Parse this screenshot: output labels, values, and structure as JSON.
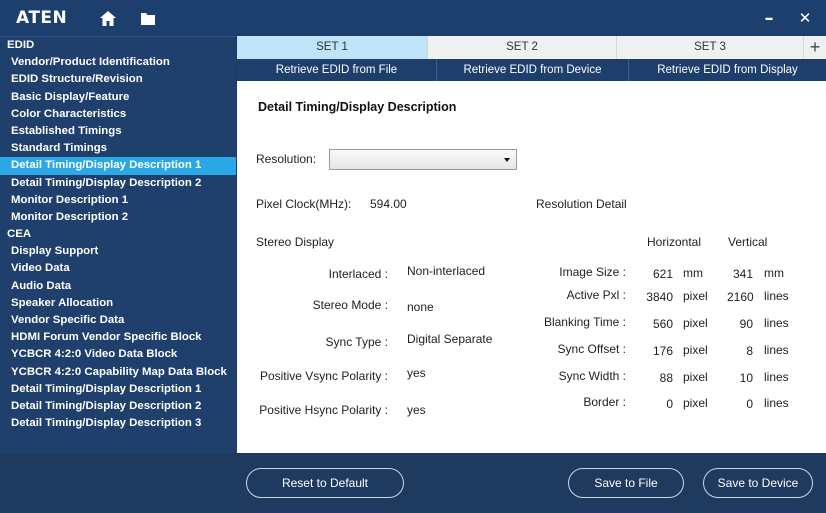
{
  "titlebar": {
    "logo": "ATEN",
    "home_icon": "home-icon",
    "folder_icon": "folder-icon",
    "minimize_label": "–",
    "close_label": "✕"
  },
  "sidebar": {
    "items": [
      {
        "label": "EDID",
        "section": true,
        "active": false
      },
      {
        "label": "Vendor/Product Identification",
        "section": false,
        "active": false
      },
      {
        "label": "EDID Structure/Revision",
        "section": false,
        "active": false
      },
      {
        "label": "Basic Display/Feature",
        "section": false,
        "active": false
      },
      {
        "label": "Color Characteristics",
        "section": false,
        "active": false
      },
      {
        "label": "Established Timings",
        "section": false,
        "active": false
      },
      {
        "label": "Standard Timings",
        "section": false,
        "active": false
      },
      {
        "label": "Detail Timing/Display Description 1",
        "section": false,
        "active": true
      },
      {
        "label": "Detail Timing/Display Description 2",
        "section": false,
        "active": false
      },
      {
        "label": "Monitor Description 1",
        "section": false,
        "active": false
      },
      {
        "label": "Monitor Description 2",
        "section": false,
        "active": false
      },
      {
        "label": "CEA",
        "section": true,
        "active": false
      },
      {
        "label": "Display Support",
        "section": false,
        "active": false
      },
      {
        "label": "Video Data",
        "section": false,
        "active": false
      },
      {
        "label": "Audio Data",
        "section": false,
        "active": false
      },
      {
        "label": "Speaker Allocation",
        "section": false,
        "active": false
      },
      {
        "label": "Vendor Specific Data",
        "section": false,
        "active": false
      },
      {
        "label": "HDMI Forum Vendor Specific Block",
        "section": false,
        "active": false
      },
      {
        "label": "YCBCR 4:2:0 Video Data Block",
        "section": false,
        "active": false
      },
      {
        "label": "YCBCR 4:2:0 Capability Map Data Block",
        "section": false,
        "active": false
      },
      {
        "label": "Detail Timing/Display Description 1",
        "section": false,
        "active": false
      },
      {
        "label": "Detail Timing/Display Description 2",
        "section": false,
        "active": false
      },
      {
        "label": "Detail Timing/Display Description 3",
        "section": false,
        "active": false
      }
    ]
  },
  "tabs": {
    "items": [
      {
        "label": "SET 1",
        "active": true
      },
      {
        "label": "SET 2",
        "active": false
      },
      {
        "label": "SET 3",
        "active": false
      }
    ],
    "add_label": "+"
  },
  "actions": {
    "retrieve_file": "Retrieve EDID from File",
    "retrieve_device": "Retrieve EDID from Device",
    "retrieve_display": "Retrieve EDID from Display"
  },
  "detail": {
    "heading": "Detail Timing/Display Description",
    "resolution_label": "Resolution:",
    "resolution_value": "",
    "pixel_clock_label": "Pixel Clock(MHz):",
    "pixel_clock_value": "594.00",
    "resolution_detail_label": "Resolution Detail",
    "stereo_display_label": "Stereo Display",
    "horizontal_label": "Horizontal",
    "vertical_label": "Vertical",
    "interlaced_label": "Interlaced :",
    "interlaced_value": "Non-interlaced",
    "stereo_mode_label": "Stereo Mode :",
    "stereo_mode_value": "none",
    "sync_type_label": "Sync Type :",
    "sync_type_value": "Digital Separate",
    "pos_vsync_label": "Positive Vsync Polarity :",
    "pos_vsync_value": "yes",
    "pos_hsync_label": "Positive Hsync Polarity :",
    "pos_hsync_value": "yes",
    "rows": [
      {
        "label": "Image Size :",
        "h_value": "621",
        "h_unit": "mm",
        "v_value": "341",
        "v_unit": "mm"
      },
      {
        "label": "Active Pxl :",
        "h_value": "3840",
        "h_unit": "pixel",
        "v_value": "2160",
        "v_unit": "lines"
      },
      {
        "label": "Blanking Time :",
        "h_value": "560",
        "h_unit": "pixel",
        "v_value": "90",
        "v_unit": "lines"
      },
      {
        "label": "Sync Offset :",
        "h_value": "176",
        "h_unit": "pixel",
        "v_value": "8",
        "v_unit": "lines"
      },
      {
        "label": "Sync Width :",
        "h_value": "88",
        "h_unit": "pixel",
        "v_value": "10",
        "v_unit": "lines"
      },
      {
        "label": "Border :",
        "h_value": "0",
        "h_unit": "pixel",
        "v_value": "0",
        "v_unit": "lines"
      }
    ]
  },
  "footer": {
    "reset_label": "Reset to Default",
    "save_file_label": "Save to File",
    "save_device_label": "Save to Device"
  },
  "colors": {
    "titlebar": "#1d3f6e",
    "sidebar": "#1f3f6d",
    "active_item": "#2aa8e6",
    "active_tab": "#bfe3f7"
  }
}
